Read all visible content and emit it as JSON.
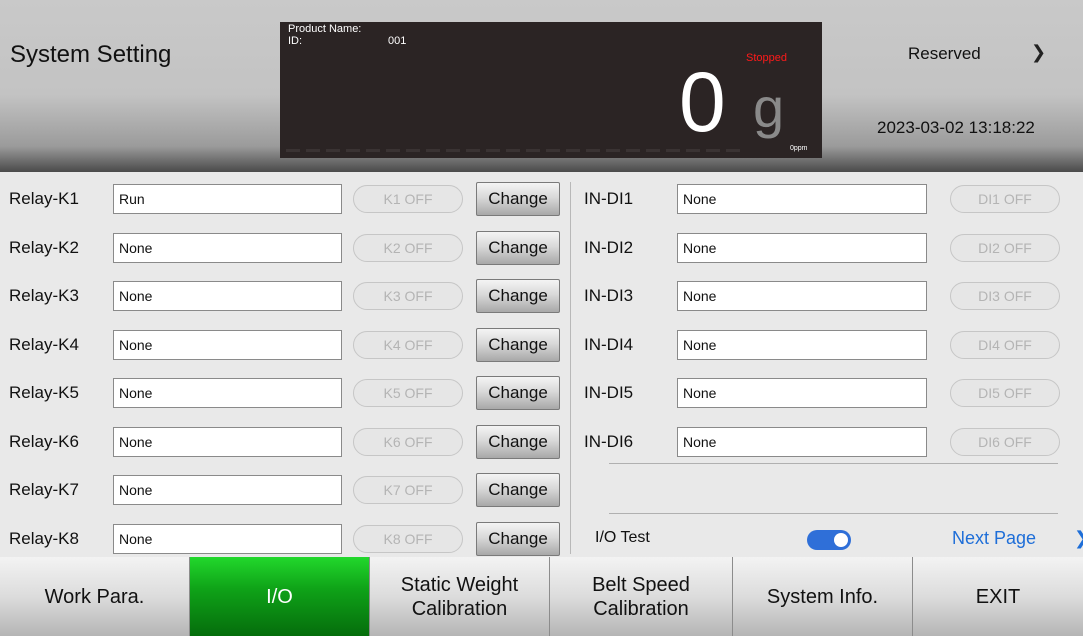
{
  "header": {
    "title": "System Setting",
    "reserved_label": "Reserved",
    "reserved_arrow": "❯",
    "datetime": "2023-03-02 13:18:22"
  },
  "display": {
    "product_name_label": "Product Name:",
    "id_label": "ID:",
    "id_value": "001",
    "status": "Stopped",
    "weight": "0",
    "unit": "g",
    "ppm": "0ppm"
  },
  "relays": [
    {
      "label": "Relay-K1",
      "value": "Run",
      "state": "K1 OFF",
      "button": "Change"
    },
    {
      "label": "Relay-K2",
      "value": "None",
      "state": "K2 OFF",
      "button": "Change"
    },
    {
      "label": "Relay-K3",
      "value": "None",
      "state": "K3 OFF",
      "button": "Change"
    },
    {
      "label": "Relay-K4",
      "value": "None",
      "state": "K4 OFF",
      "button": "Change"
    },
    {
      "label": "Relay-K5",
      "value": "None",
      "state": "K5 OFF",
      "button": "Change"
    },
    {
      "label": "Relay-K6",
      "value": "None",
      "state": "K6 OFF",
      "button": "Change"
    },
    {
      "label": "Relay-K7",
      "value": "None",
      "state": "K7 OFF",
      "button": "Change"
    },
    {
      "label": "Relay-K8",
      "value": "None",
      "state": "K8 OFF",
      "button": "Change"
    }
  ],
  "inputs": [
    {
      "label": "IN-DI1",
      "value": "None",
      "state": "DI1 OFF"
    },
    {
      "label": "IN-DI2",
      "value": "None",
      "state": "DI2 OFF"
    },
    {
      "label": "IN-DI3",
      "value": "None",
      "state": "DI3 OFF"
    },
    {
      "label": "IN-DI4",
      "value": "None",
      "state": "DI4 OFF"
    },
    {
      "label": "IN-DI5",
      "value": "None",
      "state": "DI5 OFF"
    },
    {
      "label": "IN-DI6",
      "value": "None",
      "state": "DI6 OFF"
    }
  ],
  "io_test": {
    "label": "I/O Test",
    "enabled": true
  },
  "next_page": {
    "label": "Next Page",
    "arrow": "❯"
  },
  "footer": {
    "tabs": [
      {
        "line1": "Work Para.",
        "line2": ""
      },
      {
        "line1": "I/O",
        "line2": ""
      },
      {
        "line1": "Static Weight",
        "line2": "Calibration"
      },
      {
        "line1": "Belt Speed",
        "line2": "Calibration"
      },
      {
        "line1": "System Info.",
        "line2": ""
      },
      {
        "line1": "EXIT",
        "line2": ""
      }
    ],
    "active_index": 1
  },
  "colors": {
    "active_tab": "#0fa318",
    "status_stopped": "#ff1a1a",
    "link_blue": "#1e6ed8",
    "toggle_on": "#2f6fd8"
  }
}
